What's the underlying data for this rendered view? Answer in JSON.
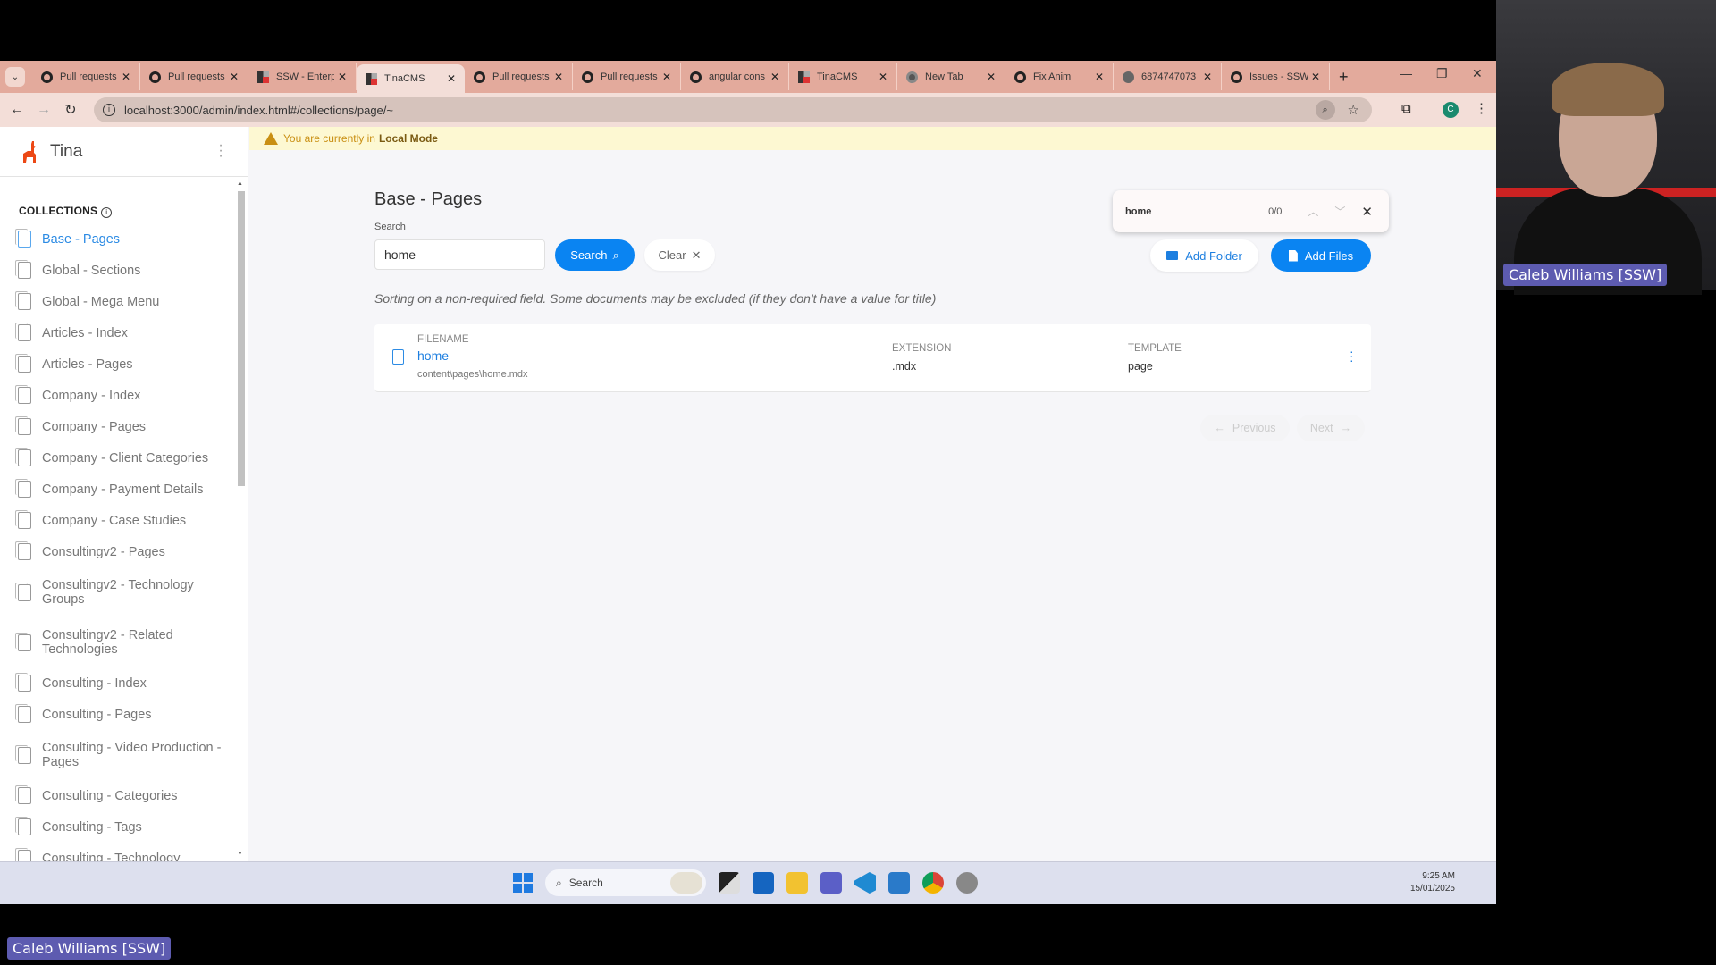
{
  "browser": {
    "tabs": [
      {
        "title": "Pull requests",
        "icon": "github"
      },
      {
        "title": "Pull requests",
        "icon": "github"
      },
      {
        "title": "SSW - Enterp",
        "icon": "ssw"
      },
      {
        "title": "TinaCMS",
        "icon": "ssw",
        "active": true
      },
      {
        "title": "Pull requests",
        "icon": "github"
      },
      {
        "title": "Pull requests",
        "icon": "github"
      },
      {
        "title": "angular cons",
        "icon": "github"
      },
      {
        "title": "TinaCMS",
        "icon": "ssw"
      },
      {
        "title": "New Tab",
        "icon": "chrome"
      },
      {
        "title": "Fix Anim",
        "icon": "github"
      },
      {
        "title": "6874747073",
        "icon": "globe"
      },
      {
        "title": "Issues - SSW",
        "icon": "github"
      }
    ],
    "url": "localhost:3000/admin/index.html#/collections/page/~",
    "profile_initial": "C",
    "find": {
      "query": "home",
      "count": "0/0"
    }
  },
  "app": {
    "brand": "Tina",
    "local_mode_prefix": "You are currently in",
    "local_mode_bold": "Local Mode",
    "collections_heading": "COLLECTIONS",
    "collections": [
      "Base - Pages",
      "Global - Sections",
      "Global - Mega Menu",
      "Articles - Index",
      "Articles - Pages",
      "Company - Index",
      "Company - Pages",
      "Company - Client Categories",
      "Company - Payment Details",
      "Company - Case Studies",
      "Consultingv2 - Pages",
      "Consultingv2 - Technology Groups",
      "Consultingv2 - Related Technologies",
      "Consulting - Index",
      "Consulting - Pages",
      "Consulting - Video Production - Pages",
      "Consulting - Categories",
      "Consulting - Tags",
      "Consulting - Technology"
    ],
    "page_title": "Base - Pages",
    "search_label": "Search",
    "search_value": "home",
    "search_button": "Search",
    "clear_button": "Clear",
    "add_folder": "Add Folder",
    "add_files": "Add Files",
    "sort_note": "Sorting on a non-required field. Some documents may be excluded (if they don't have a value for title)",
    "table": {
      "headers": {
        "filename": "FILENAME",
        "extension": "EXTENSION",
        "template": "TEMPLATE"
      },
      "rows": [
        {
          "filename": "home",
          "path": "content\\pages\\home.mdx",
          "extension": ".mdx",
          "template": "page"
        }
      ]
    },
    "pagination": {
      "previous": "Previous",
      "next": "Next"
    }
  },
  "taskbar": {
    "search": "Search",
    "time": "9:25 AM",
    "date": "15/01/2025"
  },
  "participant_name": "Caleb Williams [SSW]"
}
